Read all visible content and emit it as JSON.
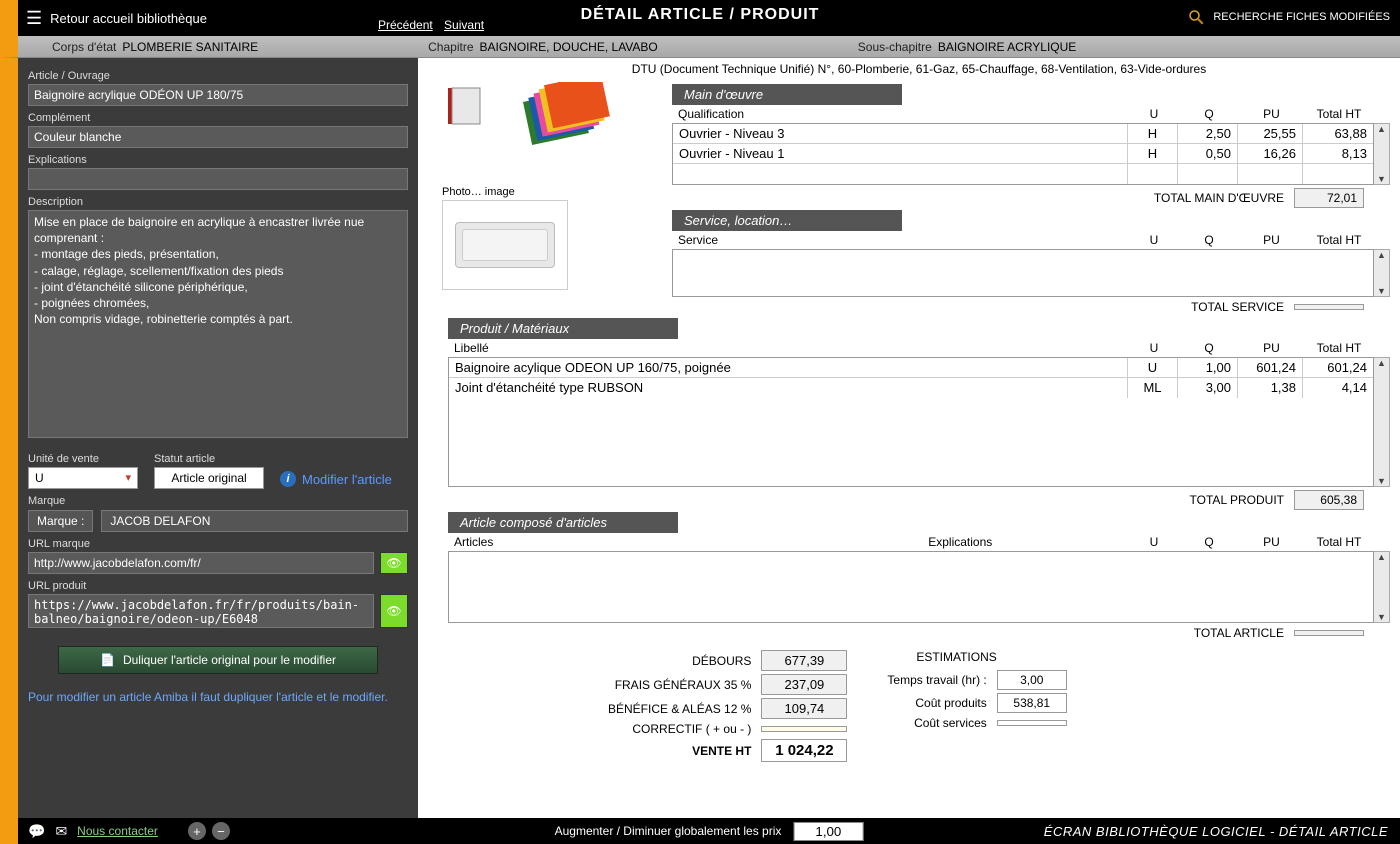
{
  "header": {
    "return": "Retour accueil bibliothèque",
    "title": "DÉTAIL ARTICLE / PRODUIT",
    "prev": "Précédent",
    "next": "Suivant",
    "search_modified": "RECHERCHE FICHES MODIFIÉES"
  },
  "breadcrumb": {
    "corps_label": "Corps d'état",
    "corps_value": "PLOMBERIE SANITAIRE",
    "chapitre_label": "Chapitre",
    "chapitre_value": "BAIGNOIRE, DOUCHE, LAVABO",
    "sous_label": "Sous-chapitre",
    "sous_value": "BAIGNOIRE ACRYLIQUE"
  },
  "left": {
    "article_label": "Article / Ouvrage",
    "article_value": "Baignoire acrylique ODÉON UP 180/75",
    "complement_label": "Complément",
    "complement_value": "Couleur blanche",
    "explications_label": "Explications",
    "explications_value": "",
    "description_label": "Description",
    "description_value": "Mise en place de baignoire en acrylique à encastrer livrée nue comprenant :\n- montage des pieds, présentation,\n- calage, réglage, scellement/fixation des pieds\n- joint d'étanchéité silicone périphérique,\n- poignées chromées,\nNon compris vidage, robinetterie comptés à part.",
    "unit_label": "Unité de vente",
    "unit_value": "U",
    "statut_label": "Statut article",
    "statut_value": "Article original",
    "modify_link": "Modifier l'article",
    "marque_section": "Marque",
    "marque_label": "Marque :",
    "marque_value": "JACOB DELAFON",
    "url_marque_label": "URL marque",
    "url_marque_value": "http://www.jacobdelafon.com/fr/",
    "url_produit_label": "URL produit",
    "url_produit_value": "https://www.jacobdelafon.fr/fr/produits/bain-balneo/baignoire/odeon-up/E6048",
    "dup_button": "Duliquer l'article original pour le modifier",
    "help_text": "Pour modifier un article Amiba il faut dupliquer l'article et le modifier."
  },
  "right": {
    "dtu_line": "DTU (Document Technique Unifié) N°, 60-Plomberie, 61-Gaz,  65-Chauffage, 68-Ventilation, 63-Vide-ordures",
    "photo_caption": "Photo… image",
    "labor": {
      "title": "Main d'œuvre",
      "head_qual": "Qualification",
      "cols": {
        "u": "U",
        "q": "Q",
        "pu": "PU",
        "tot": "Total HT"
      },
      "rows": [
        {
          "lib": "Ouvrier - Niveau 3",
          "u": "H",
          "q": "2,50",
          "pu": "25,55",
          "tot": "63,88"
        },
        {
          "lib": "Ouvrier - Niveau 1",
          "u": "H",
          "q": "0,50",
          "pu": "16,26",
          "tot": "8,13"
        }
      ],
      "total_label": "TOTAL MAIN D'ŒUVRE",
      "total": "72,01"
    },
    "service": {
      "title": "Service, location…",
      "head_lab": "Service",
      "total_label": "TOTAL SERVICE",
      "total": ""
    },
    "product": {
      "title": "Produit / Matériaux",
      "head_lab": "Libellé",
      "rows": [
        {
          "lib": "Baignoire acylique ODEON UP 160/75, poignée",
          "u": "U",
          "q": "1,00",
          "pu": "601,24",
          "tot": "601,24"
        },
        {
          "lib": "Joint d'étanchéité type RUBSON",
          "u": "ML",
          "q": "3,00",
          "pu": "1,38",
          "tot": "4,14"
        }
      ],
      "total_label": "TOTAL PRODUIT",
      "total": "605,38"
    },
    "compound": {
      "title": "Article composé d'articles",
      "head_art": "Articles",
      "head_exp": "Explications",
      "total_label": "TOTAL ARTICLE",
      "total": ""
    },
    "calc": {
      "debours_lab": "DÉBOURS",
      "debours": "677,39",
      "frais_lab": "FRAIS GÉNÉRAUX 35 %",
      "frais": "237,09",
      "benef_lab": "BÉNÉFICE & ALÉAS 12 %",
      "benef": "109,74",
      "correctif_lab": "CORRECTIF ( + ou - )",
      "correctif": "",
      "vente_lab": "VENTE HT",
      "vente": "1 024,22"
    },
    "estim": {
      "title": "ESTIMATIONS",
      "temps_lab": "Temps travail (hr) :",
      "temps": "3,00",
      "cout_prod_lab": "Coût produits",
      "cout_prod": "538,81",
      "cout_serv_lab": "Coût services",
      "cout_serv": ""
    }
  },
  "bottom": {
    "contact": "Nous contacter",
    "center_label": "Augmenter / Diminuer globalement les prix",
    "center_value": "1,00",
    "right": "ÉCRAN BIBLIOTHÈQUE LOGICIEL - DÉTAIL ARTICLE"
  }
}
